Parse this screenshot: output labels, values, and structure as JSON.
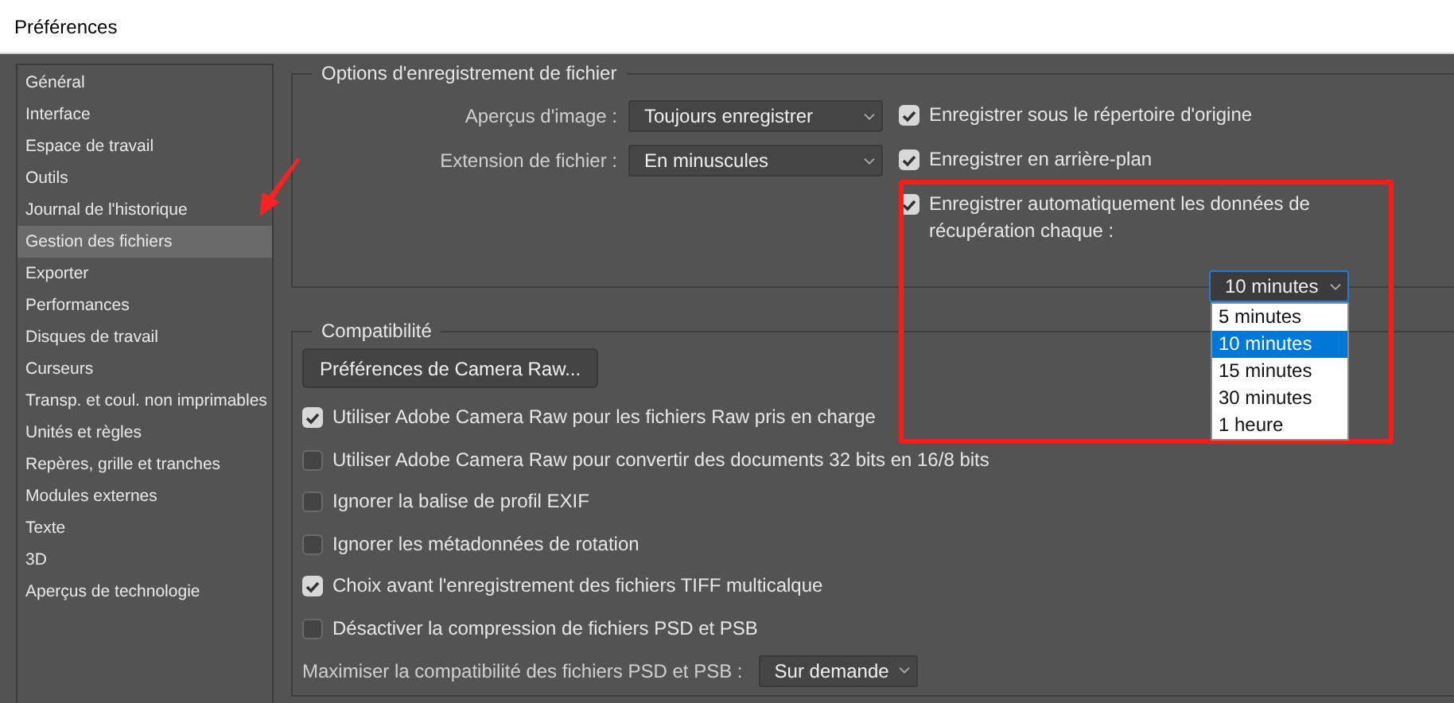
{
  "window": {
    "title": "Préférences"
  },
  "sidebar": {
    "items": [
      {
        "label": "Général",
        "selected": false
      },
      {
        "label": "Interface",
        "selected": false
      },
      {
        "label": "Espace de travail",
        "selected": false
      },
      {
        "label": "Outils",
        "selected": false
      },
      {
        "label": "Journal de l'historique",
        "selected": false
      },
      {
        "label": "Gestion des fichiers",
        "selected": true
      },
      {
        "label": "Exporter",
        "selected": false
      },
      {
        "label": "Performances",
        "selected": false
      },
      {
        "label": "Disques de travail",
        "selected": false
      },
      {
        "label": "Curseurs",
        "selected": false
      },
      {
        "label": "Transp. et coul. non imprimables",
        "selected": false
      },
      {
        "label": "Unités et règles",
        "selected": false
      },
      {
        "label": "Repères, grille et tranches",
        "selected": false
      },
      {
        "label": "Modules externes",
        "selected": false
      },
      {
        "label": "Texte",
        "selected": false
      },
      {
        "label": "3D",
        "selected": false
      },
      {
        "label": "Aperçus de technologie",
        "selected": false
      }
    ]
  },
  "file_saving_options": {
    "title": "Options d'enregistrement de fichier",
    "fields": [
      {
        "label": "Aperçus d'image :",
        "value": "Toujours enregistrer"
      },
      {
        "label": "Extension de fichier :",
        "value": "En minuscules"
      }
    ],
    "checkboxes": [
      {
        "label": "Enregistrer sous le répertoire d'origine",
        "checked": true
      },
      {
        "label": "Enregistrer en arrière-plan",
        "checked": true
      }
    ],
    "autosave": {
      "label": "Enregistrer automatiquement les données de récupération chaque :",
      "checked": true,
      "interval": {
        "value": "10 minutes",
        "expanded": true,
        "options": [
          {
            "label": "5 minutes",
            "selected": false
          },
          {
            "label": "10 minutes",
            "selected": true
          },
          {
            "label": "15 minutes",
            "selected": false
          },
          {
            "label": "30 minutes",
            "selected": false
          },
          {
            "label": "1 heure",
            "selected": false
          }
        ]
      }
    }
  },
  "compatibility": {
    "title": "Compatibilité",
    "button": "Préférences de Camera Raw...",
    "checkboxes": [
      {
        "label": "Utiliser Adobe Camera Raw pour les fichiers Raw pris en charge",
        "checked": true
      },
      {
        "label": "Utiliser Adobe Camera Raw pour convertir des documents 32 bits en 16/8 bits",
        "checked": false
      },
      {
        "label": "Ignorer la balise de profil EXIF",
        "checked": false
      },
      {
        "label": "Ignorer les métadonnées de rotation",
        "checked": false
      },
      {
        "label": "Choix avant l'enregistrement des fichiers TIFF multicalque",
        "checked": true
      },
      {
        "label": "Désactiver la compression de fichiers PSD et PSB",
        "checked": false
      }
    ],
    "maximize": {
      "label": "Maximiser la compatibilité des fichiers PSD et PSB :",
      "value": "Sur demande"
    }
  },
  "annotation_marks": {
    "arrow": true,
    "highlight_box": true
  }
}
